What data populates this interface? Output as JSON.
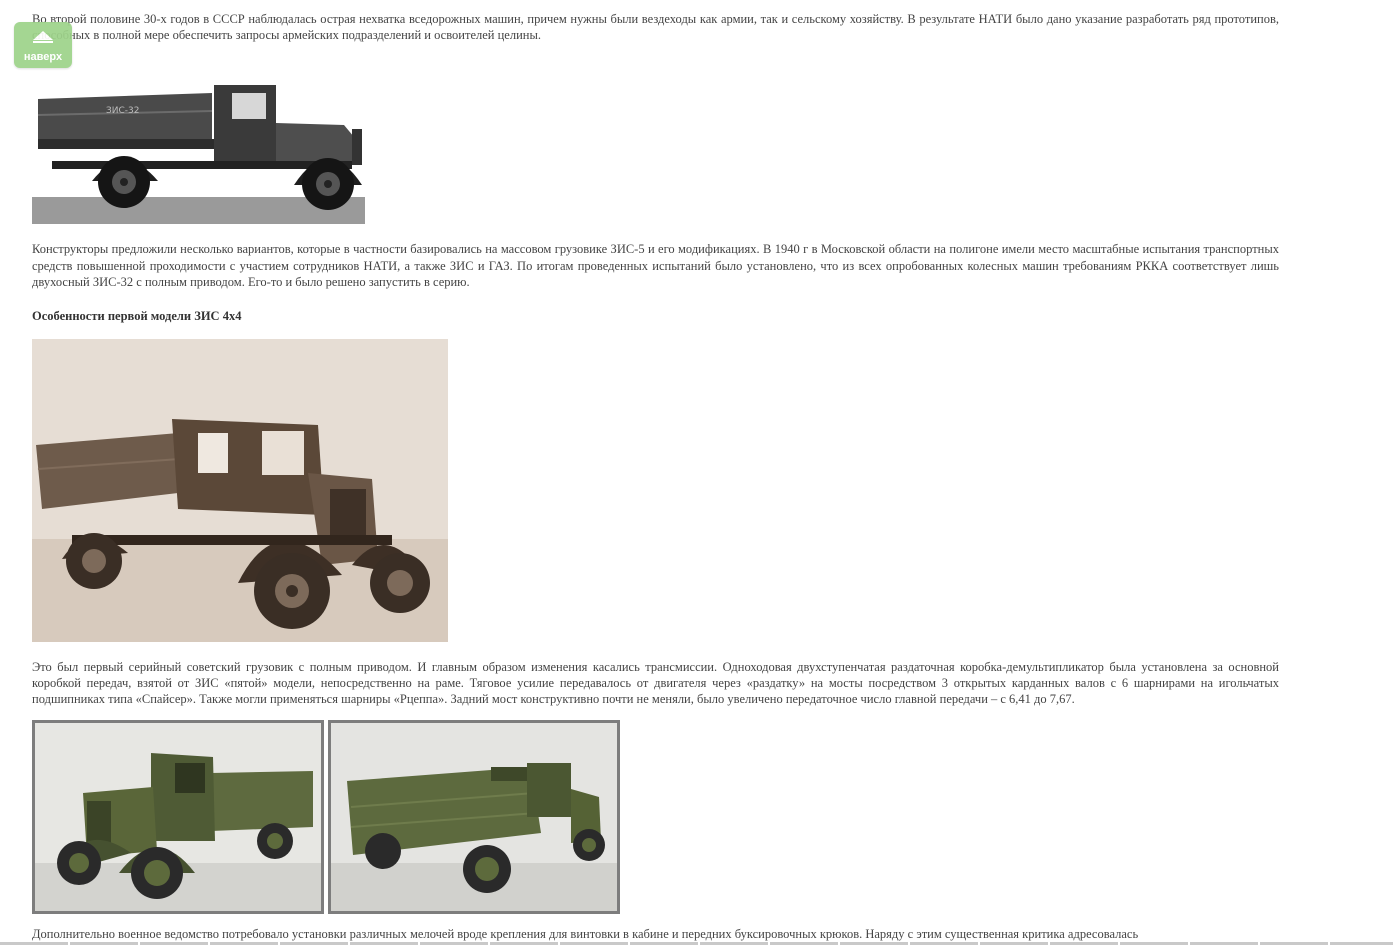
{
  "scroll_button": {
    "label": "наверх",
    "icon": "up-arrow-icon",
    "color": "#9ed38a"
  },
  "article": {
    "paragraph_1": "Во второй половине 30-х годов в СССР наблюдалась острая нехватка вседорожных машин, причем нужны были вездеходы как армии, так и сельскому хозяйству. В результате НАТИ было дано указание разработать ряд прототипов, способных в полной мере обеспечить запросы армейских подразделений и освоителей целины.",
    "photo_1_caption_plate": "ЗИС-32",
    "paragraph_2": "Конструкторы предложили несколько вариантов, которые в частности базировались на массовом грузовике ЗИС-5 и его модификациях. В 1940 г в Московской области на полигоне имели место масштабные испытания транспортных средств повышенной проходимости с участием сотрудников НАТИ, а также ЗИС и ГАЗ. По итогам проведенных испытаний было установлено, что из всех опробованных колесных машин требованиям РККА соответствует лишь двухосный ЗИС-32 с полным приводом. Его-то и было решено запустить в серию.",
    "heading": "Особенности первой модели ЗИС 4х4",
    "paragraph_3": "Это был первый серийный советский грузовик с полным приводом. И главным образом изменения касались трансмиссии. Одноходовая двухступенчатая раздаточная коробка-демультипликатор была установлена за основной коробкой передач, взятой от ЗИС «пятой» модели, непосредственно на раме. Тяговое усилие передавалось от двигателя через «раздатку» на мосты посредством 3 открытых карданных валов с 6 шарнирами на игольчатых подшипниках типа «Спайсер». Также могли применяться шарниры «Рцеппа». Задний мост конструктивно почти не меняли, было увеличено передаточное число главной передачи – с 6,41 до 7,67.",
    "paragraph_4": "Дополнительно военное ведомство потребовало установки различных мелочей вроде крепления для винтовки в кабине и передних буксировочных крюков. Наряду с этим существенная критика адресовалась"
  }
}
